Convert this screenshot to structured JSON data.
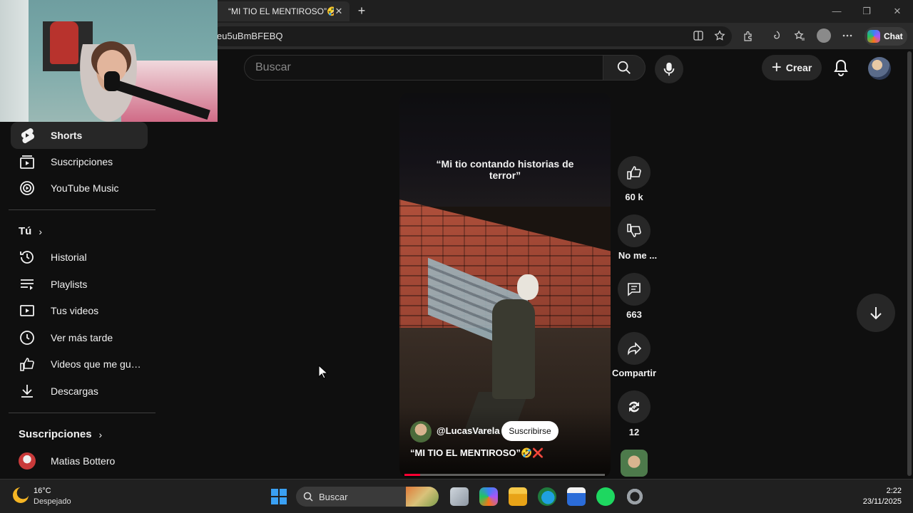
{
  "browser": {
    "tab_title": "“MI TIO EL MENTIROSO”🤣❌",
    "tab_close": "✕",
    "new_tab": "+",
    "url": "eu5uBmBFEBQ",
    "chat_label": "Chat",
    "window_controls": [
      "—",
      "❐",
      "✕"
    ]
  },
  "youtube": {
    "search_placeholder": "Buscar",
    "create_label": "Crear",
    "sidebar": {
      "items_top": [
        {
          "label": "Shorts",
          "icon": "shorts-icon",
          "active": true
        },
        {
          "label": "Suscripciones",
          "icon": "subscriptions-icon"
        },
        {
          "label": "YouTube Music",
          "icon": "youtube-music-icon"
        }
      ],
      "you_heading": "Tú",
      "you_items": [
        {
          "label": "Historial",
          "icon": "history-icon"
        },
        {
          "label": "Playlists",
          "icon": "playlists-icon"
        },
        {
          "label": "Tus videos",
          "icon": "your-videos-icon"
        },
        {
          "label": "Ver más tarde",
          "icon": "watch-later-icon"
        },
        {
          "label": "Videos que me gus...",
          "icon": "liked-videos-icon"
        },
        {
          "label": "Descargas",
          "icon": "downloads-icon"
        }
      ],
      "subs_heading": "Suscripciones",
      "subs_items": [
        {
          "label": "Matias Bottero",
          "icon": "channel-avatar"
        }
      ]
    },
    "short": {
      "overlay_text": "“Mi tio contando historias de terror”",
      "channel": "@LucasVarela",
      "subscribe_label": "Suscribirse",
      "title": "“MI TIO EL MENTIROSO”🤣❌",
      "progress": 0.08
    },
    "actions": {
      "like_count": "60 k",
      "dislike_label": "No me ...",
      "comments_count": "663",
      "share_label": "Compartir",
      "remix_count": "12"
    }
  },
  "taskbar": {
    "weather_temp": "16°C",
    "weather_desc": "Despejado",
    "search_label": "Buscar",
    "time": "2:22",
    "date": "23/11/2025"
  },
  "colors": {
    "background": "#0f0f0f",
    "accent_red": "#ff0033",
    "chip": "#272727",
    "taskbar": "#202020"
  }
}
